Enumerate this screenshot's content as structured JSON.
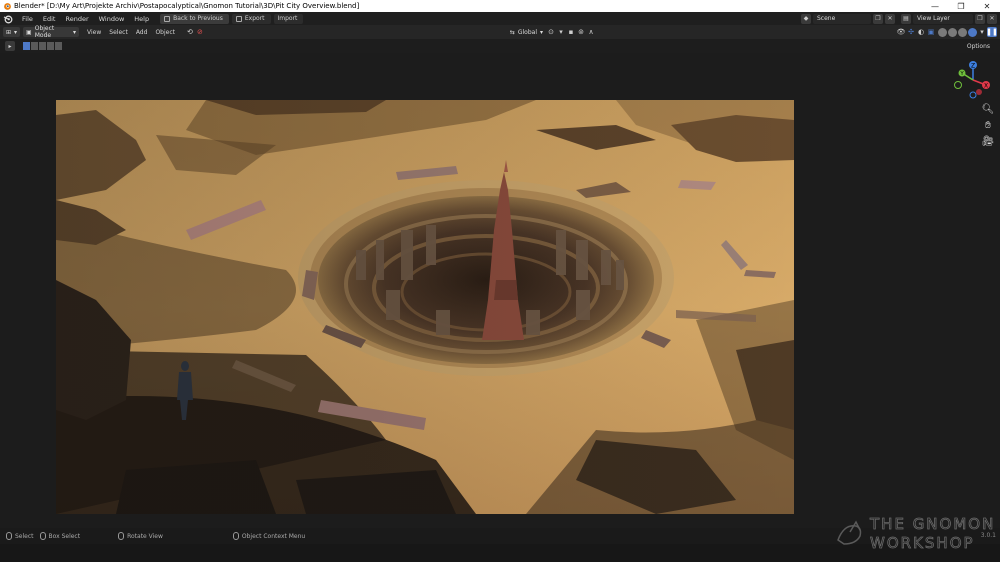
{
  "window": {
    "title": "Blender* [D:\\My Art\\Projekte Archiv\\Postapocalyptical\\Gnomon Tutorial\\3D\\Pit City Overview.blend]",
    "minimize": "—",
    "maximize": "❐",
    "close": "✕"
  },
  "menubar": {
    "items": [
      "File",
      "Edit",
      "Render",
      "Window",
      "Help"
    ],
    "back_to_previous": "Back to Previous",
    "export": "Export",
    "import": "Import",
    "scene": "Scene",
    "view_layer": "View Layer"
  },
  "header3d": {
    "mode": "Object Mode",
    "menus": [
      "View",
      "Select",
      "Add",
      "Object"
    ],
    "transform_orientation": "Global",
    "options": "Options"
  },
  "statusbar": {
    "select": "Select",
    "box_select": "Box Select",
    "rotate_view": "Rotate View",
    "context_menu": "Object Context Menu",
    "version": "3.0.1"
  },
  "watermark": {
    "line1": "THE GNOMON",
    "line2": "WORKSHOP"
  },
  "gizmo": {
    "x": "X",
    "y": "Y",
    "z": "Z"
  },
  "colors": {
    "accent": "#4d79c7",
    "sand": "#d4a460",
    "axis_x": "#e0394a",
    "axis_y": "#6fbf3c",
    "axis_z": "#3d7fe0"
  }
}
